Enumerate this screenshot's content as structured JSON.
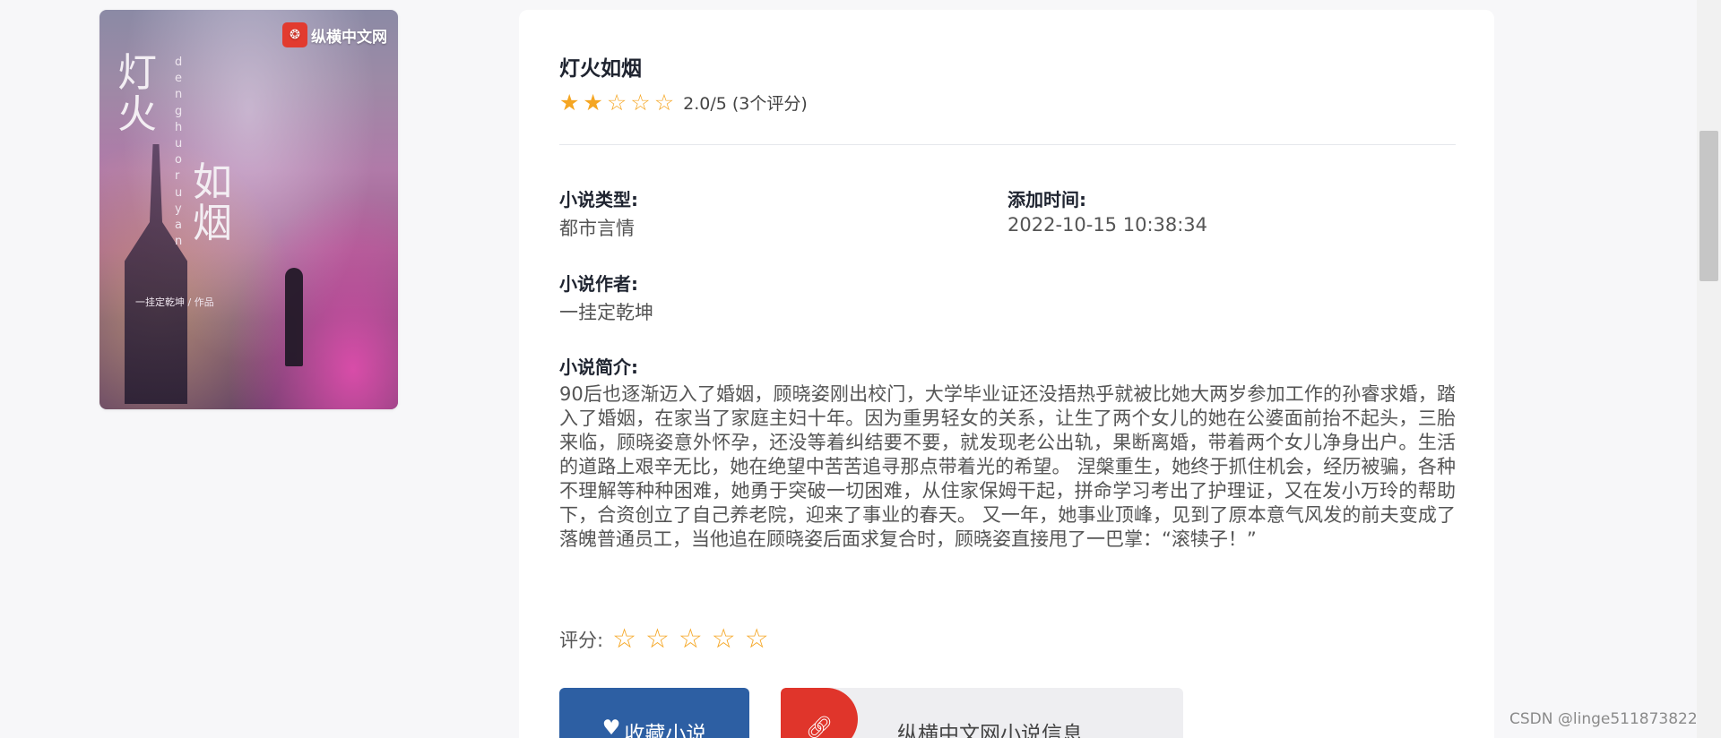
{
  "cover": {
    "logo_text": "纵横中文网",
    "title_chars_1": "灯\n火",
    "title_chars_2": "如\n烟",
    "pinyin": "denghuoruyan",
    "author_line": "一挂定乾坤 / 作品"
  },
  "book": {
    "title": "灯火如烟",
    "rating": 2.0,
    "rating_text": "2.0/5 (3个评分)",
    "type_label": "小说类型:",
    "type_value": "都市言情",
    "added_label": "添加时间:",
    "added_value": "2022-10-15 10:38:34",
    "author_label": "小说作者:",
    "author_value": "一挂定乾坤",
    "intro_label": "小说简介:",
    "intro": "90后也逐渐迈入了婚姻，顾晓姿刚出校门，大学毕业证还没捂热乎就被比她大两岁参加工作的孙睿求婚，踏入了婚姻，在家当了家庭主妇十年。因为重男轻女的关系，让生了两个女儿的她在公婆面前抬不起头，三胎来临，顾晓姿意外怀孕，还没等着纠结要不要，就发现老公出轨，果断离婚，带着两个女儿净身出户。生活的道路上艰辛无比，她在绝望中苦苦追寻那点带着光的希望。 涅槃重生，她终于抓住机会，经历被骗，各种不理解等种种困难，她勇于突破一切困难，从住家保姆干起，拼命学习考出了护理证，又在发小万玲的帮助下，合资创立了自己养老院，迎来了事业的春天。 又一年，她事业顶峰，见到了原本意气风发的前夫变成了落魄普通员工，当他追在顾晓姿后面求复合时，顾晓姿直接甩了一巴掌：“滚犊子！”"
  },
  "score": {
    "label": "评分:",
    "max": 5
  },
  "buttons": {
    "favorite": "收藏小说",
    "source": "纵横中文网小说信息"
  },
  "icons": {
    "heart": "heart-icon",
    "link": "link-icon",
    "star": "star-icon"
  },
  "colors": {
    "accent_blue": "#2d5fa3",
    "accent_red": "#e0352b",
    "star": "#f5a623"
  },
  "watermark": "CSDN @linge511873822"
}
